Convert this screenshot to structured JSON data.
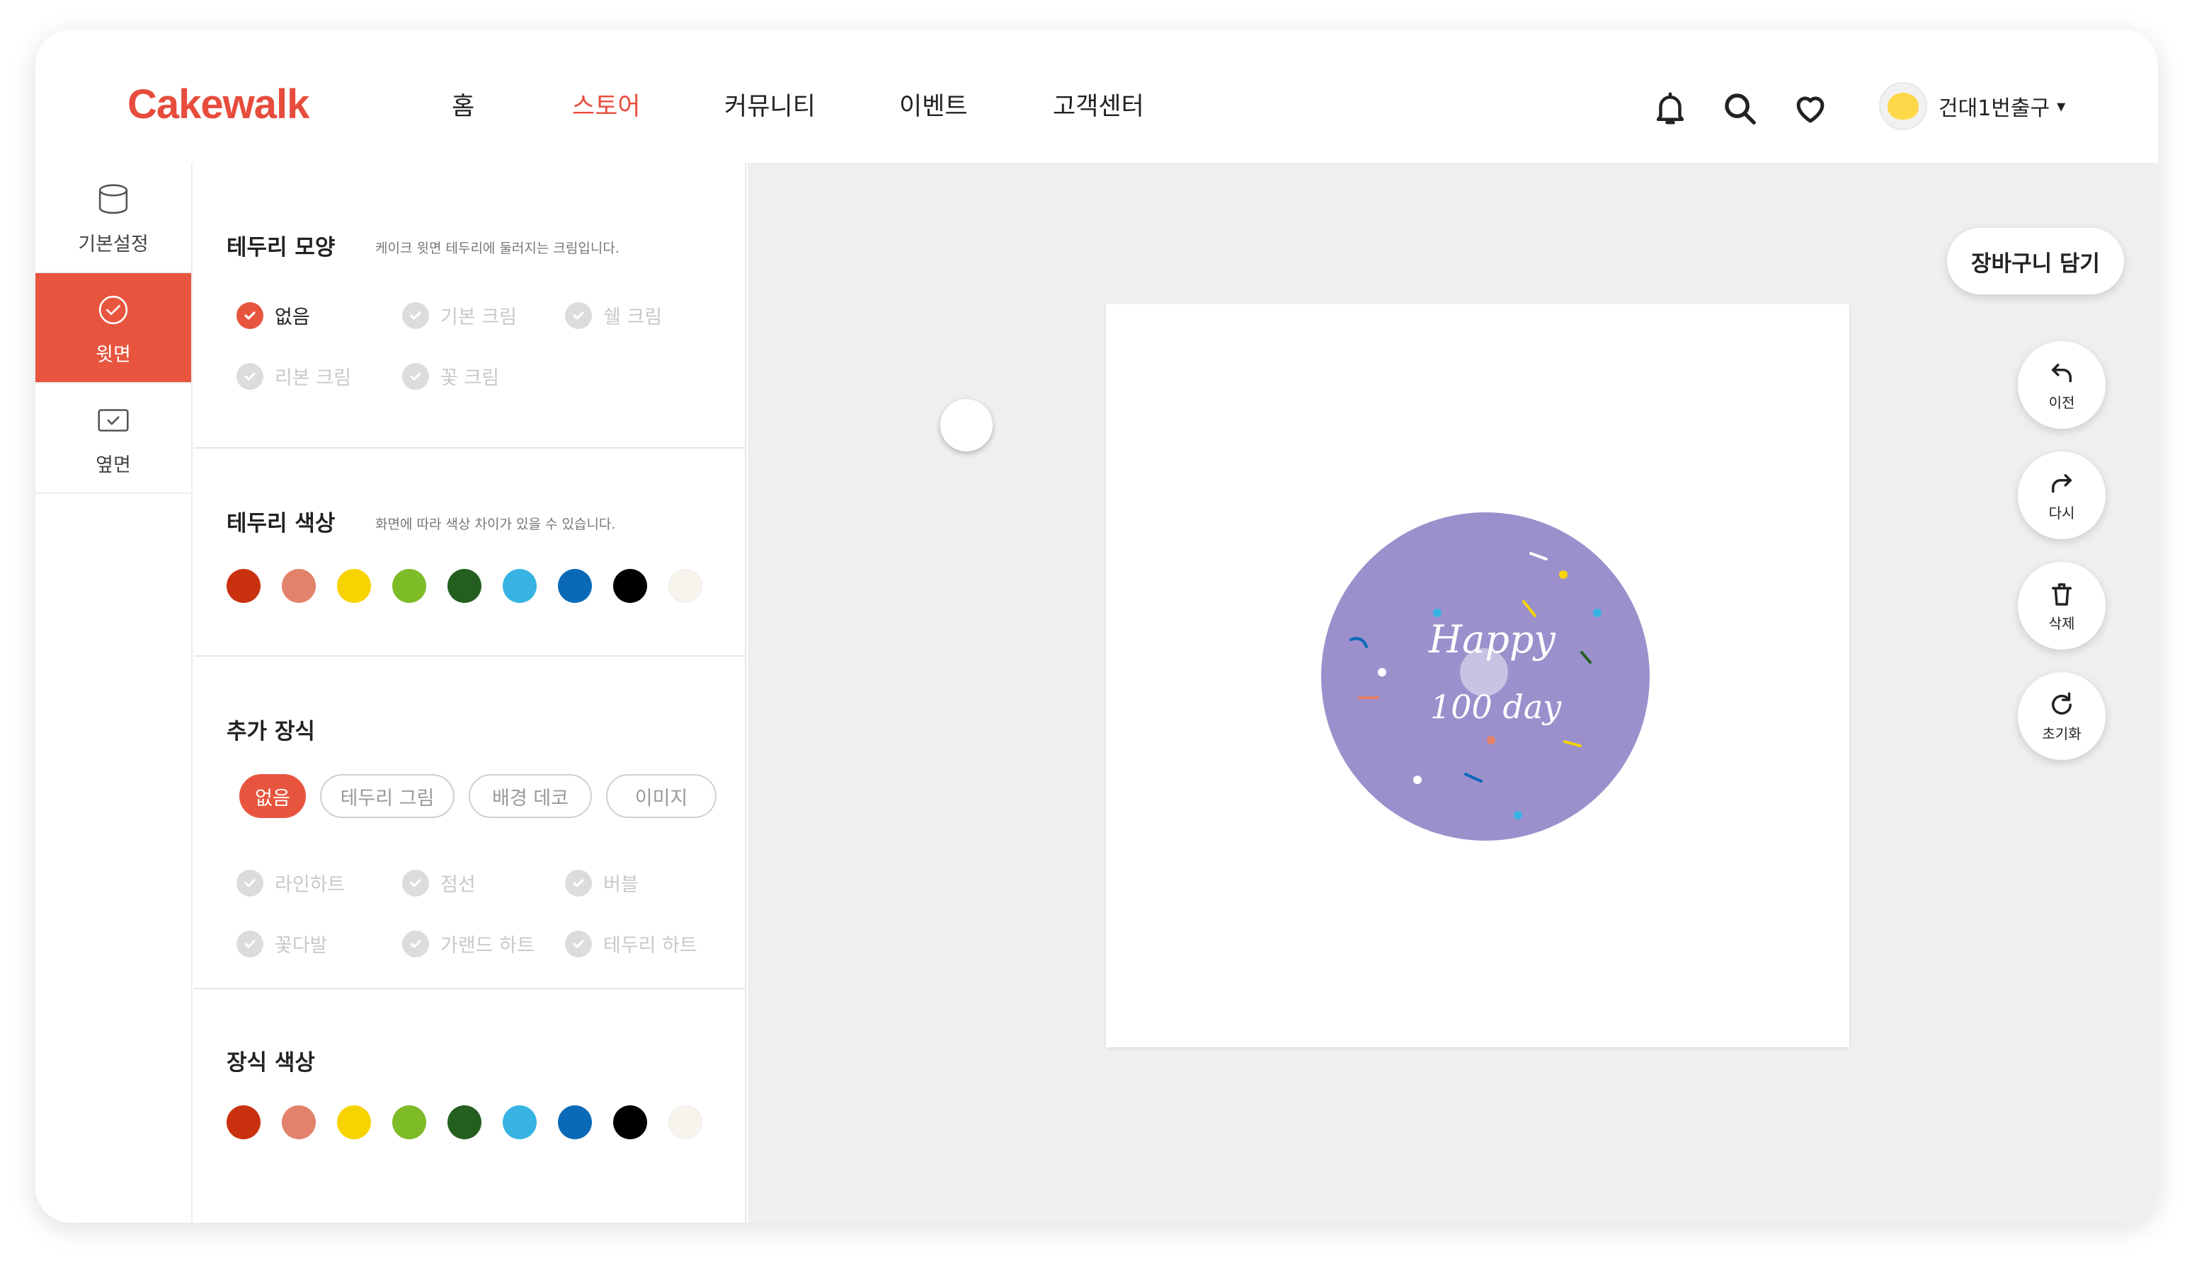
{
  "app": {
    "logo": "Cakewalk"
  },
  "nav": {
    "items": [
      "홈",
      "스토어",
      "커뮤니티",
      "이벤트",
      "고객센터"
    ],
    "active": "스토어"
  },
  "header": {
    "icons": [
      "bell-icon",
      "search-icon",
      "heart-icon"
    ]
  },
  "user": {
    "name": "건대1번출구",
    "caret": "▾"
  },
  "rail": {
    "items": [
      {
        "label": "기본설정",
        "icon": "cake-outline-icon"
      },
      {
        "label": "윗면",
        "icon": "check-circle-icon"
      },
      {
        "label": "옆면",
        "icon": "checkbox-icon"
      }
    ],
    "active": "윗면"
  },
  "border_shape": {
    "title": "테두리 모양",
    "note": "케이크 윗면 테두리에 둘러지는 크림입니다.",
    "options": [
      "없음",
      "기본 크림",
      "쉘 크림",
      "리본 크림",
      "꽃 크림"
    ],
    "selected": "없음"
  },
  "border_color": {
    "title": "테두리 색상",
    "note": "화면에 따라 색상 차이가 있을 수 있습니다.",
    "swatches": [
      "#c9310e",
      "#e3826a",
      "#f7d300",
      "#7dbb27",
      "#245f20",
      "#37b3e3",
      "#0a6ab8",
      "#000000",
      "#f8f3ec"
    ]
  },
  "extra_deco": {
    "title": "추가 장식",
    "categories": [
      "없음",
      "테두리 그림",
      "배경 데코",
      "이미지"
    ],
    "selected_category": "없음",
    "options": [
      "라인하트",
      "점선",
      "버블",
      "꽃다발",
      "가랜드 하트",
      "테두리 하트"
    ]
  },
  "deco_color": {
    "title": "장식 색상",
    "swatches": [
      "#c9310e",
      "#e3826a",
      "#f7d300",
      "#7dbb27",
      "#245f20",
      "#37b3e3",
      "#0a6ab8",
      "#000000",
      "#f8f3ec"
    ]
  },
  "canvas": {
    "cake_color": "#9b90cc",
    "text_line1": "Happy",
    "text_line2": "100 day"
  },
  "actions": {
    "cart": "장바구니 담기",
    "tools": [
      {
        "label": "이전",
        "icon": "undo-icon"
      },
      {
        "label": "다시",
        "icon": "redo-icon"
      },
      {
        "label": "삭제",
        "icon": "trash-icon"
      },
      {
        "label": "초기화",
        "icon": "reset-icon"
      }
    ]
  },
  "colors": {
    "accent": "#e8553f",
    "stage_bg": "#efefef"
  }
}
